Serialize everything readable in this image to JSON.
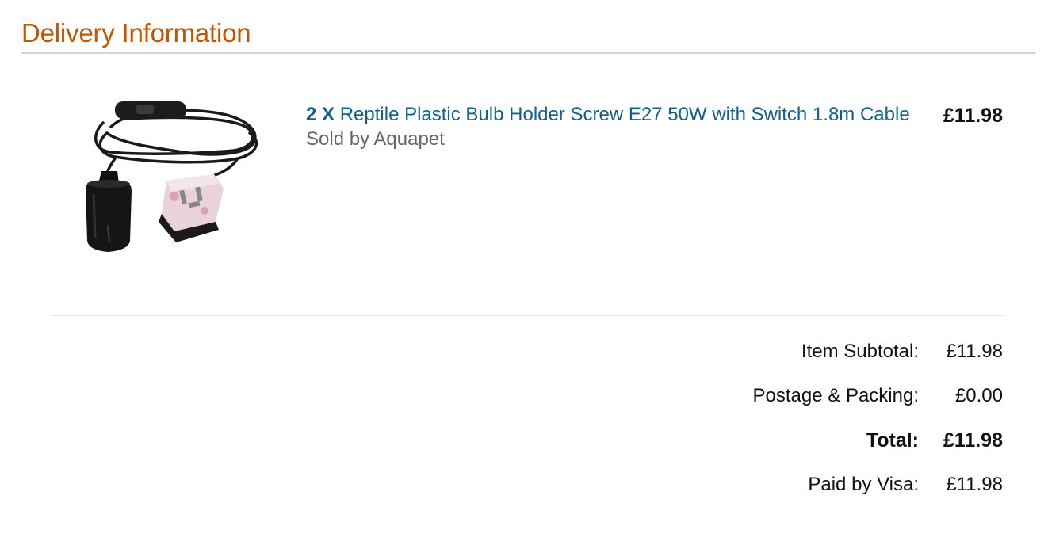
{
  "section": {
    "title": "Delivery Information"
  },
  "item": {
    "quantity": "2 X",
    "name": "Reptile Plastic Bulb Holder Screw E27 50W with Switch 1.8m Cable",
    "seller": "Sold by Aquapet",
    "price": "£11.98",
    "image_icon": "bulb-holder-cable-image"
  },
  "summary": {
    "rows": [
      {
        "label": "Item Subtotal:",
        "value": "£11.98"
      },
      {
        "label": "Postage & Packing:",
        "value": "£0.00"
      },
      {
        "label": "Total:",
        "value": "£11.98"
      },
      {
        "label": "Paid by Visa:",
        "value": "£11.98"
      }
    ]
  },
  "colors": {
    "title": "#c45500",
    "link": "#0f628c",
    "seller": "#666666",
    "text": "#111111",
    "rule": "#d5d5d5"
  }
}
